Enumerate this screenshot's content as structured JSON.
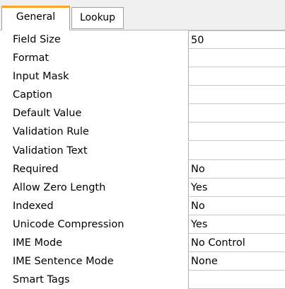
{
  "tabs": [
    {
      "label": "General",
      "active": true
    },
    {
      "label": "Lookup",
      "active": false
    }
  ],
  "properties": [
    {
      "label": "Field Size",
      "value": "50"
    },
    {
      "label": "Format",
      "value": ""
    },
    {
      "label": "Input Mask",
      "value": ""
    },
    {
      "label": "Caption",
      "value": ""
    },
    {
      "label": "Default Value",
      "value": ""
    },
    {
      "label": "Validation Rule",
      "value": ""
    },
    {
      "label": "Validation Text",
      "value": ""
    },
    {
      "label": "Required",
      "value": "No"
    },
    {
      "label": "Allow Zero Length",
      "value": "Yes"
    },
    {
      "label": "Indexed",
      "value": "No"
    },
    {
      "label": "Unicode Compression",
      "value": "Yes"
    },
    {
      "label": "IME Mode",
      "value": "No Control"
    },
    {
      "label": "IME Sentence Mode",
      "value": "None"
    },
    {
      "label": "Smart Tags",
      "value": ""
    }
  ],
  "colors": {
    "active_tab_accent": "#f5a623",
    "tabstrip_background": "#f0f0f0"
  }
}
